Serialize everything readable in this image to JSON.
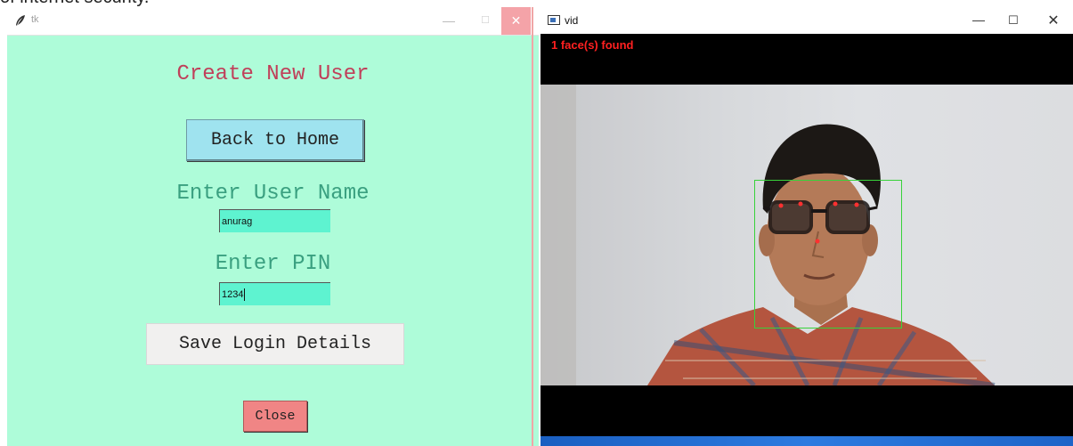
{
  "top_strip_text": "of internet security.",
  "tk_window": {
    "title": "tk",
    "controls": {
      "minimize": "—",
      "maximize": "☐",
      "close": "✕"
    },
    "heading": "Create New User",
    "back_button": "Back to Home",
    "username_label": "Enter User Name",
    "username_value": "anurag",
    "pin_label": "Enter PIN",
    "pin_value": "1234",
    "save_button": "Save Login Details",
    "close_button": "Close"
  },
  "vid_window": {
    "title": "vid",
    "controls": {
      "minimize": "—",
      "maximize": "☐",
      "close": "✕"
    },
    "faces_found_text": "1 face(s) found"
  },
  "colors": {
    "tk_background": "#aefcd9",
    "heading_red": "#c0405a",
    "label_green": "#3aa080",
    "back_button": "#9fe3ef",
    "entry_fill": "#5ef3d0",
    "close_button": "#f08585",
    "face_box": "#38d23a",
    "overlay_text": "#ff2020"
  }
}
